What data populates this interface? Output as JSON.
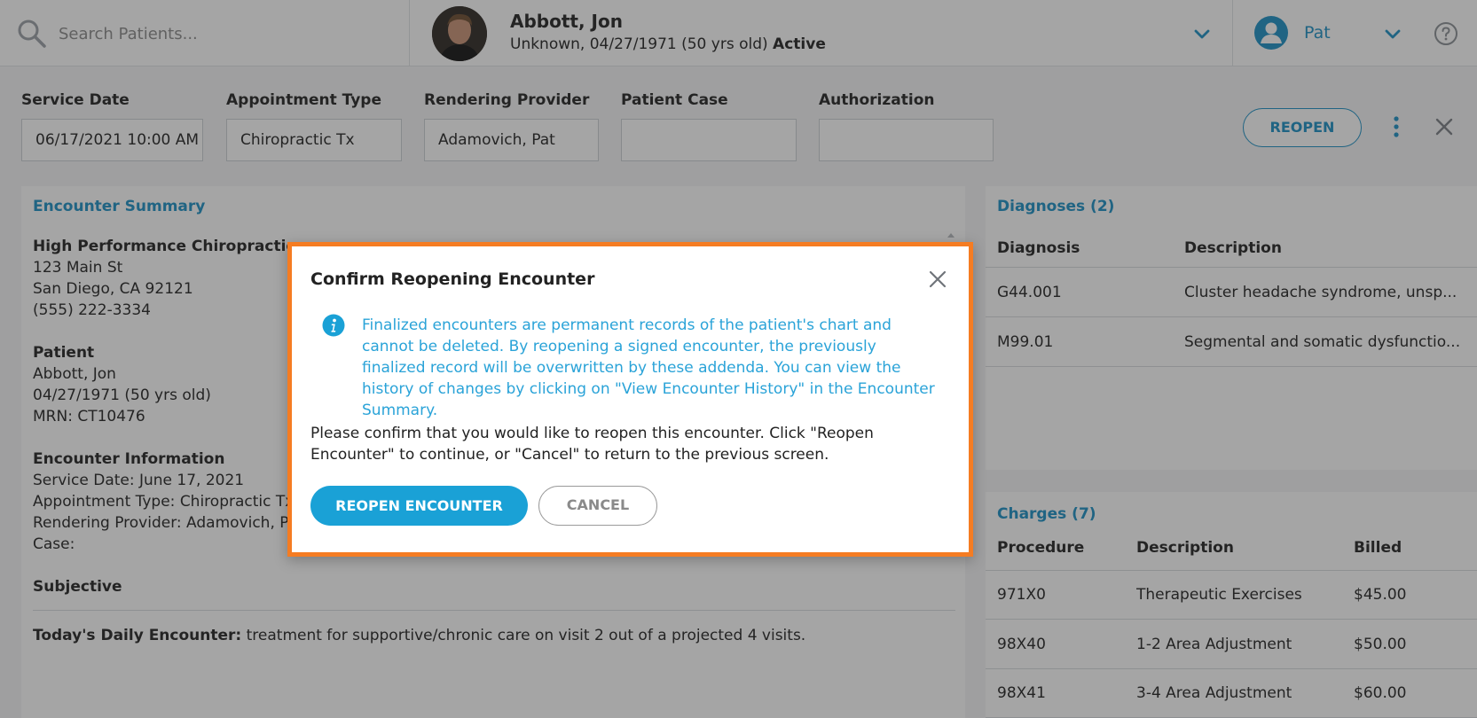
{
  "search": {
    "placeholder": "Search Patients..."
  },
  "patient": {
    "name": "Abbott, Jon",
    "details": "Unknown, 04/27/1971 (50 yrs old)",
    "status": "Active"
  },
  "user": {
    "name": "Pat"
  },
  "form": {
    "service_date": {
      "label": "Service Date",
      "value": "06/17/2021 10:00 AM"
    },
    "appointment_type": {
      "label": "Appointment Type",
      "value": "Chiropractic Tx"
    },
    "rendering_provider": {
      "label": "Rendering Provider",
      "value": "Adamovich, Pat"
    },
    "patient_case": {
      "label": "Patient Case",
      "value": ""
    },
    "authorization": {
      "label": "Authorization",
      "value": ""
    }
  },
  "toolbar": {
    "reopen_label": "REOPEN"
  },
  "summary": {
    "title": "Encounter Summary",
    "practice_name": "High Performance Chiropractic",
    "practice_address1": "123 Main St",
    "practice_address2": "San Diego, CA 92121",
    "practice_phone": "(555) 222-3334",
    "patient_heading": "Patient",
    "patient_name": "Abbott, Jon",
    "patient_dob": "04/27/1971 (50 yrs old)",
    "patient_mrn": "MRN: CT10476",
    "encounter_heading": "Encounter Information",
    "service_date": "Service Date: June 17, 2021",
    "appointment_type": "Appointment Type: Chiropractic Tx",
    "rendering_provider": "Rendering Provider: Adamovich, Pat",
    "case": "Case:",
    "subjective_heading": "Subjective",
    "daily_label": "Today's Daily Encounter:",
    "daily_text": " treatment for supportive/chronic care on visit 2 out of a projected 4 visits."
  },
  "diagnoses": {
    "title": "Diagnoses (2)",
    "columns": [
      "Diagnosis",
      "Description"
    ],
    "rows": [
      {
        "code": "G44.001",
        "description": "Cluster headache syndrome, unsp..."
      },
      {
        "code": "M99.01",
        "description": "Segmental and somatic dysfunctio..."
      }
    ]
  },
  "charges": {
    "title": "Charges (7)",
    "columns": [
      "Procedure",
      "Description",
      "Billed"
    ],
    "rows": [
      {
        "procedure": "971X0",
        "description": "Therapeutic Exercises",
        "billed": "$45.00"
      },
      {
        "procedure": "98X40",
        "description": "1-2 Area Adjustment",
        "billed": "$50.00"
      },
      {
        "procedure": "98X41",
        "description": "3-4 Area Adjustment",
        "billed": "$60.00"
      }
    ]
  },
  "modal": {
    "title": "Confirm Reopening Encounter",
    "info": "Finalized encounters are permanent records of the patient's chart and cannot be deleted. By reopening a signed encounter, the previously finalized record will be overwritten by these addenda. You can view the history of changes by clicking on \"View Encounter History\" in the Encounter Summary.",
    "confirm": "Please confirm that you would like to reopen this encounter. Click \"Reopen Encounter\" to continue, or \"Cancel\" to return to the previous screen.",
    "primary_label": "REOPEN ENCOUNTER",
    "cancel_label": "CANCEL"
  },
  "colors": {
    "accent": "#1a8fc4",
    "primary_button": "#1aa1d6",
    "modal_border": "#f57c22",
    "info_text": "#2aa3d8"
  },
  "icons": [
    "search-icon",
    "chevron-down-icon",
    "user-icon",
    "help-icon",
    "kebab-menu-icon",
    "close-icon",
    "info-icon"
  ]
}
